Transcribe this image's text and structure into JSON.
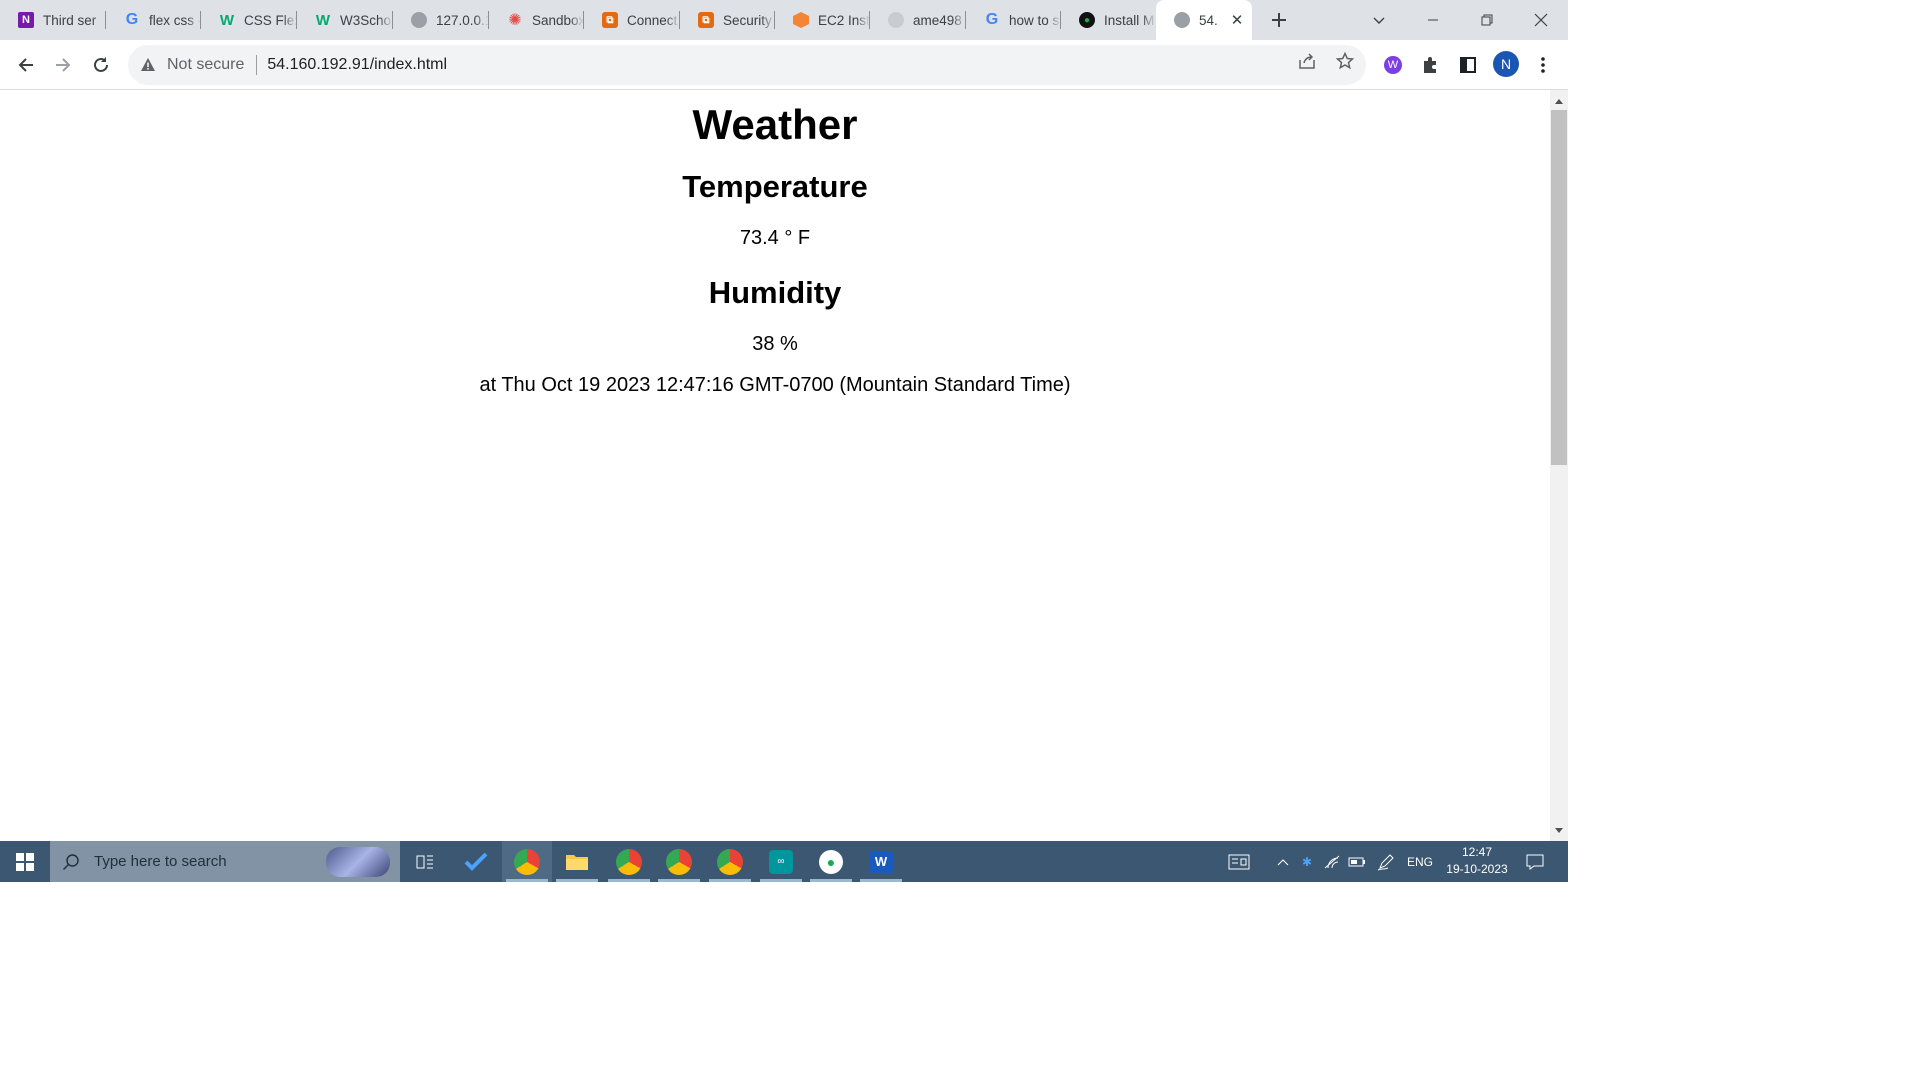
{
  "browser": {
    "tabs": [
      {
        "label": "Third ser",
        "favicon": "onenote-icon"
      },
      {
        "label": "flex css -",
        "favicon": "google-icon"
      },
      {
        "label": "CSS Flex",
        "favicon": "w3schools-icon"
      },
      {
        "label": "W3Scho",
        "favicon": "w3schools-icon"
      },
      {
        "label": "127.0.0.1",
        "favicon": "globe-icon"
      },
      {
        "label": "Sandbox",
        "favicon": "sandbox-icon"
      },
      {
        "label": "Connect",
        "favicon": "aws-icon"
      },
      {
        "label": "Security",
        "favicon": "aws-icon"
      },
      {
        "label": "EC2 Inst",
        "favicon": "ec2-icon"
      },
      {
        "label": "ame498",
        "favicon": "github-icon"
      },
      {
        "label": "how to s",
        "favicon": "google-icon"
      },
      {
        "label": "Install M",
        "favicon": "mongodb-icon"
      },
      {
        "label": "54.",
        "favicon": "globe-icon",
        "active": true
      }
    ],
    "address_bar": {
      "security_label": "Not secure",
      "url": "54.160.192.91/index.html"
    },
    "profile_initial": "N"
  },
  "page": {
    "title": "Weather",
    "temperature_heading": "Temperature",
    "temperature_value": "73.4 ° F",
    "humidity_heading": "Humidity",
    "humidity_value": "38 %",
    "timestamp": "at Thu Oct 19 2023 12:47:16 GMT-0700 (Mountain Standard Time)"
  },
  "taskbar": {
    "search_placeholder": "Type here to search",
    "language": "ENG",
    "time": "12:47",
    "date": "19-10-2023"
  }
}
